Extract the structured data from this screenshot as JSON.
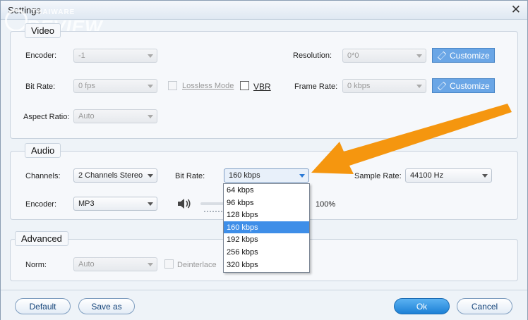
{
  "window": {
    "title": "Settings",
    "close_symbol": "✕"
  },
  "watermark": {
    "top": "THAIWARE",
    "main": "REVIEW"
  },
  "video": {
    "group_label": "Video",
    "encoder_label": "Encoder:",
    "encoder_value": "-1",
    "bitrate_label": "Bit Rate:",
    "bitrate_value": "0 fps",
    "lossless_label": "Lossless Mode",
    "vbr_label": "VBR",
    "aspect_label": "Aspect Ratio:",
    "aspect_value": "Auto",
    "resolution_label": "Resolution:",
    "resolution_value": "0*0",
    "framerate_label": "Frame Rate:",
    "framerate_value": "0 kbps",
    "customize_label": "Customize"
  },
  "audio": {
    "group_label": "Audio",
    "channels_label": "Channels:",
    "channels_value": "2 Channels Stereo",
    "bitrate_label": "Bit Rate:",
    "bitrate_value": "160 kbps",
    "samplerate_label": "Sample Rate:",
    "samplerate_value": "44100 Hz",
    "encoder_label": "Encoder:",
    "encoder_value": "MP3",
    "volume_value": "100%",
    "bitrate_options": [
      "64 kbps",
      "96 kbps",
      "128 kbps",
      "160 kbps",
      "192 kbps",
      "256 kbps",
      "320 kbps"
    ],
    "selected_option": "160 kbps"
  },
  "advanced": {
    "group_label": "Advanced",
    "norm_label": "Norm:",
    "norm_value": "Auto",
    "deinterlace_label": "Deinterlace"
  },
  "buttons": {
    "default": "Default",
    "save_as": "Save as",
    "ok": "Ok",
    "cancel": "Cancel"
  },
  "colors": {
    "accent": "#3e8ee8",
    "customize_button": "#6aa6e6",
    "annotation_arrow": "#f5960f"
  }
}
